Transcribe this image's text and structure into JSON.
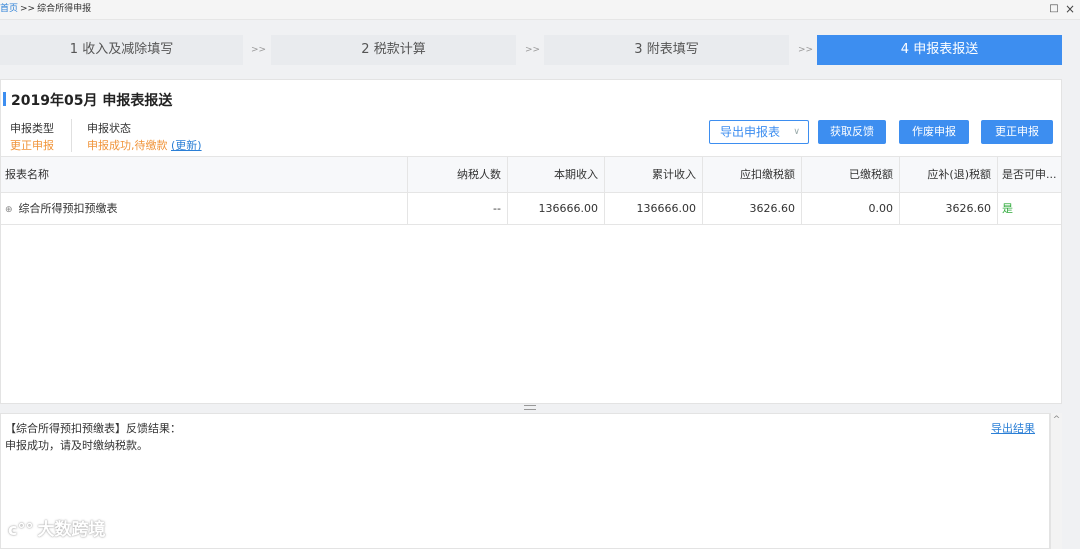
{
  "breadcrumb": {
    "home": "首页",
    "sep": ">>",
    "current": "综合所得申报"
  },
  "window": {
    "maximize_icon": "□",
    "close_icon": "×"
  },
  "steps": [
    {
      "label": "1 收入及减除填写",
      "active": false
    },
    {
      "label": "2 税款计算",
      "active": false
    },
    {
      "label": "3 附表填写",
      "active": false
    },
    {
      "label": "4 申报表报送",
      "active": true
    }
  ],
  "step_separator": ">>",
  "header": {
    "title": "2019年05月  申报表报送",
    "type_label": "申报类型",
    "type_value": "更正申报",
    "status_label": "申报状态",
    "status_value": "申报成功,待缴款",
    "refresh_link": "(更新)"
  },
  "toolbar": {
    "export_report": "导出申报表",
    "get_feedback": "获取反馈",
    "void_report": "作废申报",
    "correct_report": "更正申报"
  },
  "table": {
    "columns": [
      "报表名称",
      "纳税人数",
      "本期收入",
      "累计收入",
      "应扣缴税额",
      "已缴税额",
      "应补(退)税额",
      "是否可申..."
    ],
    "rows": [
      [
        "综合所得预扣预缴表",
        "--",
        "136666.00",
        "136666.00",
        "3626.60",
        "0.00",
        "3626.60",
        "是"
      ]
    ]
  },
  "feedback": {
    "title": "【综合所得预扣预缴表】反馈结果：",
    "message": "申报成功，请及时缴纳税款。",
    "export_link": "导出结果"
  },
  "watermark": "大数跨境",
  "colors": {
    "primary": "#3d8ef0",
    "warning": "#f0943a",
    "success": "#2eaa3a",
    "link": "#2b7fd6"
  }
}
